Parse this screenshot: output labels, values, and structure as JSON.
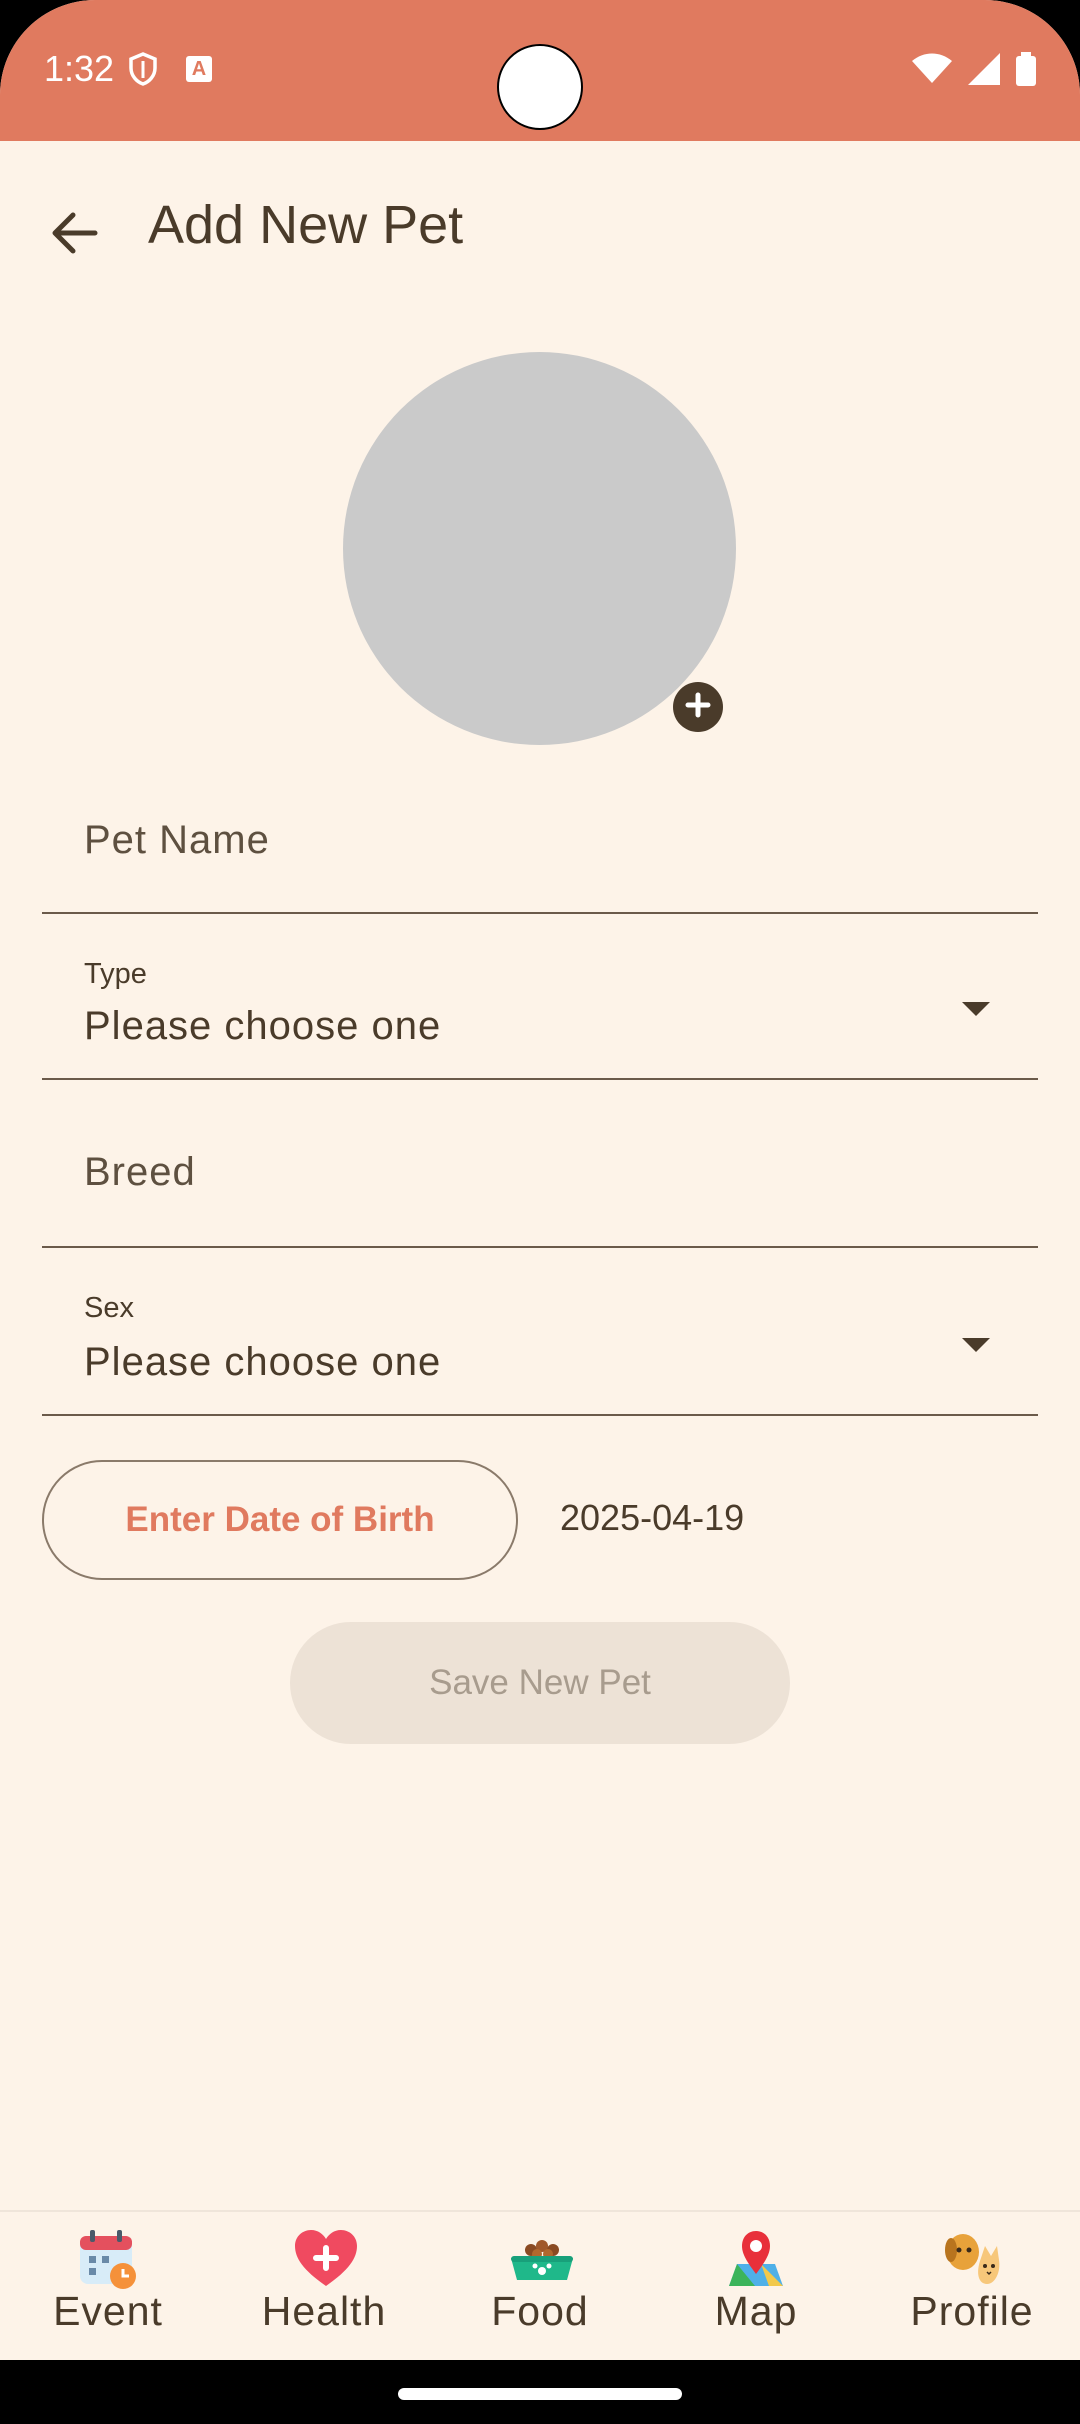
{
  "status_bar": {
    "time": "1:32"
  },
  "app_bar": {
    "title": "Add New Pet"
  },
  "form": {
    "pet_name": {
      "placeholder": "Pet Name"
    },
    "type": {
      "label": "Type",
      "value": "Please choose one"
    },
    "breed": {
      "placeholder": "Breed"
    },
    "sex": {
      "label": "Sex",
      "value": "Please choose one"
    },
    "dob_button": "Enter Date of Birth",
    "dob_value": "2025-04-19",
    "save_button": "Save New Pet"
  },
  "bottom_nav": {
    "items": [
      {
        "label": "Event",
        "icon": "calendar-icon"
      },
      {
        "label": "Health",
        "icon": "heart-icon"
      },
      {
        "label": "Food",
        "icon": "food-bowl-icon"
      },
      {
        "label": "Map",
        "icon": "map-pin-icon"
      },
      {
        "label": "Profile",
        "icon": "dog-cat-icon"
      }
    ]
  },
  "colors": {
    "accent": "#E07A5F",
    "background": "#FDF3E8",
    "text": "#4A3B2A",
    "disabled_button": "#EDE2D6"
  }
}
